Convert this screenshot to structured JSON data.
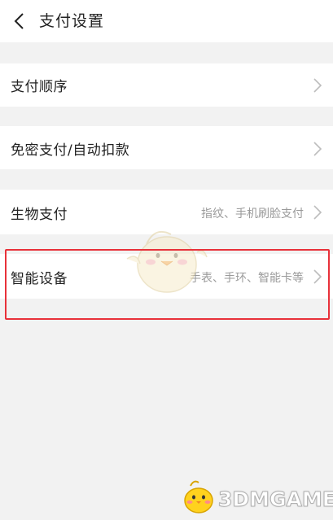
{
  "header": {
    "title": "支付设置",
    "back_icon": "back-chevron-icon"
  },
  "rows": [
    {
      "label": "支付顺序",
      "sub": ""
    },
    {
      "label": "免密支付/自动扣款",
      "sub": ""
    },
    {
      "label": "生物支付",
      "sub": "指纹、手机刷脸支付"
    },
    {
      "label": "智能设备",
      "sub": "手表、手环、智能卡等"
    }
  ],
  "highlight_color": "#e8313a",
  "watermark": {
    "text": "3DMGAME"
  }
}
